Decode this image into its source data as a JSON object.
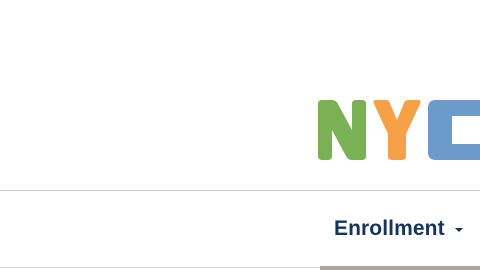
{
  "logo": {
    "letters": [
      "N",
      "Y",
      "C"
    ],
    "colors": {
      "n": "#7ab154",
      "y": "#f6a148",
      "c": "#6b9acb"
    }
  },
  "nav": {
    "items": [
      {
        "label": "Enrollment",
        "icon": "caret-down-icon"
      }
    ],
    "text_color": "#14345a"
  }
}
